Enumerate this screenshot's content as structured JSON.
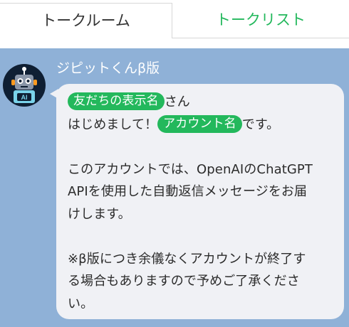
{
  "tabs": {
    "talk_room": "トークルーム",
    "talk_list": "トークリスト"
  },
  "bot": {
    "name": "ジピットくんβ版",
    "avatar_label": "AI",
    "avatar_icon": "robot-icon"
  },
  "message": {
    "friend_tag": "友だちの表示名",
    "after_friend": "さん",
    "greeting_before": "はじめまして！",
    "account_tag": "アカウント名",
    "greeting_after": "です。",
    "para2_line1": "このアカウントでは、OpenAIのChatGPT",
    "para2_line2": "APIを使用した自動返信メッセージをお届",
    "para2_line3": "けします。",
    "para3_line1": "※β版につき余儀なくアカウントが終了す",
    "para3_line2": "る場合もありますので予めご了承くださ",
    "para3_line3": "い。"
  },
  "colors": {
    "accent_green": "#23b85c",
    "chat_background": "#8fb1d7",
    "bubble_background": "#f0f1f5",
    "avatar_background": "#0f1f33"
  }
}
